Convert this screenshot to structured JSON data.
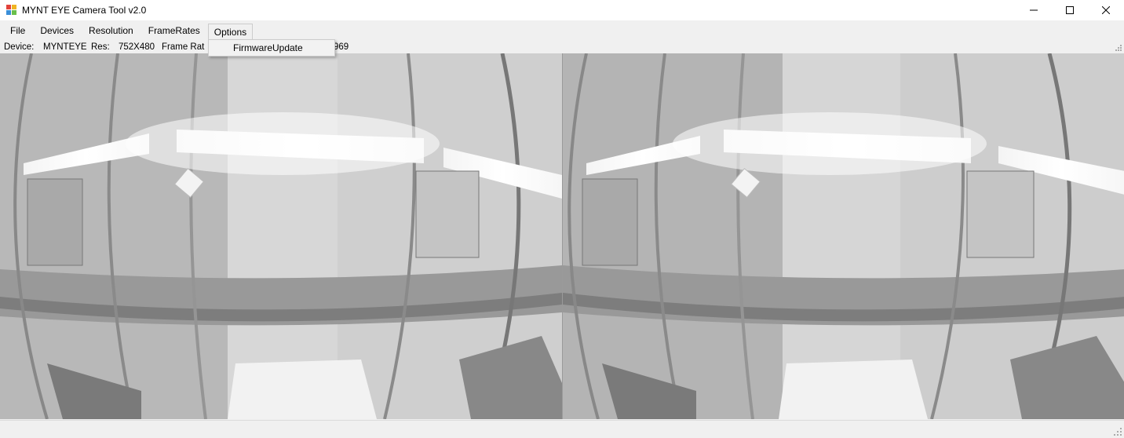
{
  "window": {
    "title": "MYNT EYE Camera Tool v2.0",
    "controls": [
      "minimize-icon",
      "maximize-icon",
      "close-icon"
    ]
  },
  "menubar": {
    "items": [
      {
        "label": "File"
      },
      {
        "label": "Devices"
      },
      {
        "label": "Resolution"
      },
      {
        "label": "FrameRates"
      },
      {
        "label": "Options",
        "open": true
      }
    ]
  },
  "options_menu": {
    "items": [
      {
        "label": "FirmwareUpdate"
      }
    ]
  },
  "infobar": {
    "device_label": "Device:",
    "device_value": "MYNTEYE",
    "res_label": "Res:",
    "res_value": "752X480",
    "frame_rate_label": "Frame Rat",
    "trailing_visible": "969"
  },
  "views": {
    "left_camera": "left-camera-view",
    "right_camera": "right-camera-view"
  },
  "colors": {
    "window_bg": "#f0f0f0",
    "titlebar_bg": "#ffffff",
    "menu_border": "#cccccc"
  }
}
